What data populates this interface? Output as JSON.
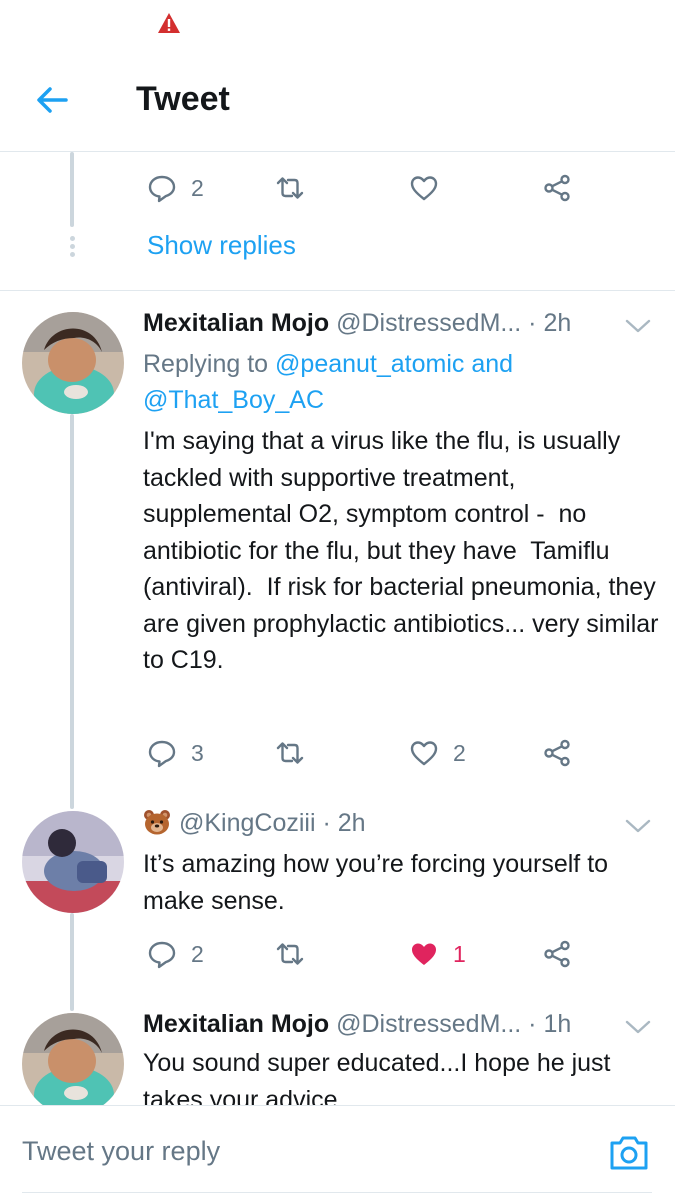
{
  "header": {
    "title": "Tweet"
  },
  "prev_tweet": {
    "reply_count": "2",
    "show_replies_label": "Show replies"
  },
  "tweets": [
    {
      "name": "Mexitalian Mojo",
      "handle": "@DistressedM...",
      "sep": " · ",
      "time": "2h",
      "replying_prefix": "Replying to ",
      "mention_1": "@peanut_atomic",
      "replying_and": " and",
      "mention_2": "@That_Boy_AC",
      "text": "I'm saying that a virus like the flu, is usually tackled with supportive treatment, supplemental O2, symptom control -  no antibiotic for the flu, but they have  Tamiflu (antiviral).  If risk for bacterial pneumonia, they are given prophylactic antibiotics... very similar to C19.",
      "reply_count": "3",
      "like_count": "2"
    },
    {
      "name": "",
      "handle": "@KingCoziii",
      "sep": " · ",
      "time": "2h",
      "text": "It’s amazing how you’re forcing yourself to make sense.",
      "reply_count": "2",
      "like_count": "1",
      "liked": true
    },
    {
      "name": "Mexitalian Mojo",
      "handle": "@DistressedM...",
      "sep": " · ",
      "time": "1h",
      "text": "You sound super educated...I hope he just takes your advice"
    }
  ],
  "reply_bar": {
    "placeholder": "Tweet your reply"
  },
  "colors": {
    "accent": "#1da1f2",
    "like": "#e0245e",
    "muted": "#657786",
    "warning": "#d32f2f"
  },
  "icons": [
    "warning-icon",
    "back-arrow-icon",
    "reply-icon",
    "retweet-icon",
    "like-icon",
    "share-icon",
    "chevron-down-icon",
    "bear-emoji",
    "camera-icon"
  ]
}
